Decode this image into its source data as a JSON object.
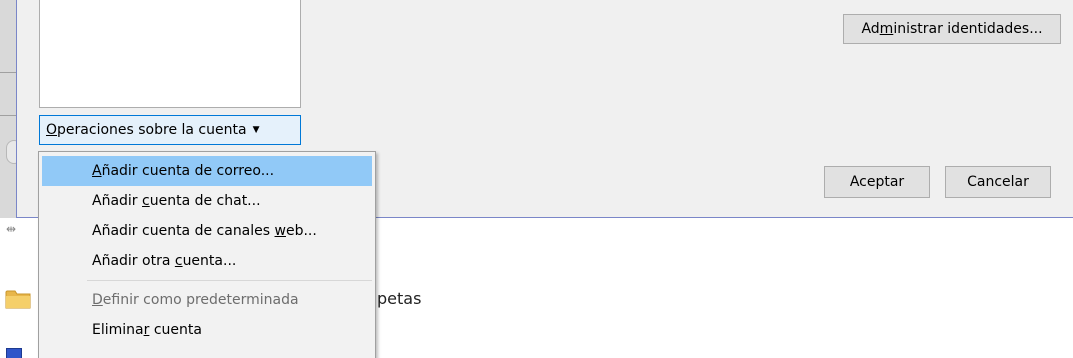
{
  "dialog": {
    "manage_identities": {
      "pre": "Ad",
      "key": "m",
      "post": "inistrar identidades..."
    },
    "account_operations": {
      "pre": "",
      "key": "O",
      "post": "peraciones sobre la cuenta"
    },
    "accept_label": "Aceptar",
    "cancel_label": "Cancelar"
  },
  "menu": {
    "items": [
      {
        "pre": "",
        "key": "A",
        "post": "ñadir cuenta de correo...",
        "state": "highlighted"
      },
      {
        "pre": "Añadir ",
        "key": "c",
        "post": "uenta de chat...",
        "state": "normal"
      },
      {
        "pre": "Añadir cuenta de canales ",
        "key": "w",
        "post": "eb...",
        "state": "normal"
      },
      {
        "pre": "Añadir otra ",
        "key": "c",
        "post": "uenta...",
        "state": "normal"
      },
      {
        "pre": "",
        "key": "D",
        "post": "efinir como predeterminada",
        "state": "disabled"
      },
      {
        "pre": "Elimina",
        "key": "r",
        "post": " cuenta",
        "state": "normal"
      }
    ]
  },
  "background": {
    "folder_text": "petas"
  },
  "icons": {
    "caret": "caret-down-icon",
    "folder": "folder-icon",
    "resize": "resize-handle-icon"
  }
}
